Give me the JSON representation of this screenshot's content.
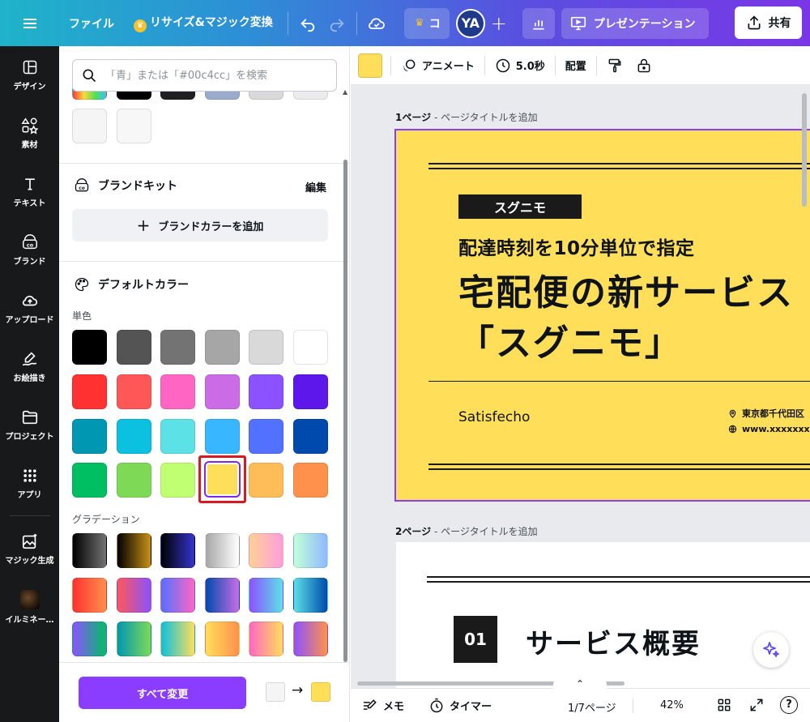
{
  "topbar": {
    "file_label": "ファイル",
    "resize_label": "リサイズ&マジック変換",
    "team_label": "コ",
    "avatar_initials": "YA",
    "present_label": "プレゼンテーション",
    "share_label": "共有",
    "gradient": [
      "#1fb3c9",
      "#7a36e6"
    ]
  },
  "rail": {
    "items": [
      {
        "label": "デザイン",
        "icon": "layout-icon"
      },
      {
        "label": "素材",
        "icon": "shapes-icon"
      },
      {
        "label": "テキスト",
        "icon": "text-icon"
      },
      {
        "label": "ブランド",
        "icon": "brand-icon"
      },
      {
        "label": "アップロード",
        "icon": "cloud-upload-icon"
      },
      {
        "label": "お絵描き",
        "icon": "draw-icon"
      },
      {
        "label": "プロジェクト",
        "icon": "folder-icon"
      },
      {
        "label": "アプリ",
        "icon": "apps-grid-icon"
      },
      {
        "label": "マジック生成",
        "icon": "magic-image-icon"
      },
      {
        "label": "イルミネー…",
        "icon": "thumbnail"
      }
    ]
  },
  "panel": {
    "search_placeholder": "「青」または「#00c4cc」を検索",
    "recent_colors": [
      "gradient",
      "#000000",
      "#202020",
      "#9aaccc",
      "#d9d9d9",
      "#ececec",
      "#f5f5f5",
      "#f7f7f7"
    ],
    "brand_kit_title": "ブランドキット",
    "edit_label": "編集",
    "add_brand_color_label": "ブランドカラーを追加",
    "default_colors_title": "デフォルトカラー",
    "solid_label": "単色",
    "solid_colors": [
      [
        "#000000",
        "#545454",
        "#737373",
        "#a6a6a6",
        "#d9d9d9",
        "#ffffff"
      ],
      [
        "#ff3131",
        "#ff5757",
        "#ff66c4",
        "#cb6ce6",
        "#8c52ff",
        "#5e17eb"
      ],
      [
        "#0097b2",
        "#0cc0df",
        "#5ce1e6",
        "#38b6ff",
        "#5271ff",
        "#004aad"
      ],
      [
        "#00bf63",
        "#7ed957",
        "#c1ff72",
        "#ffde59",
        "#ffbd59",
        "#ff914d"
      ]
    ],
    "selected_color": "#ffde59",
    "gradient_label": "グラデーション",
    "gradients": [
      [
        [
          "#000000",
          "#737373"
        ],
        [
          "#000000",
          "#c89116"
        ],
        [
          "#000000",
          "#3533cd"
        ],
        [
          "#a6a6a6",
          "#ffffff"
        ],
        [
          "#ffd194",
          "#ff9de0"
        ],
        [
          "#c2ffd8",
          "#8fb8ff"
        ]
      ],
      [
        [
          "#ff3131",
          "#ff914d"
        ],
        [
          "#ff5757",
          "#8c52ff"
        ],
        [
          "#5271ff",
          "#ff66c4"
        ],
        [
          "#004aad",
          "#cb6ce6"
        ],
        [
          "#8c52ff",
          "#5ce1e6"
        ],
        [
          "#5ce1e6",
          "#004aad"
        ]
      ],
      [
        [
          "#8c52ff",
          "#00bf63"
        ],
        [
          "#0097b2",
          "#7ed957"
        ],
        [
          "#0cc0df",
          "#ffde59"
        ],
        [
          "#ffde59",
          "#ff914d"
        ],
        [
          "#ff66c4",
          "#ffde59"
        ],
        [
          "#8c52ff",
          "#ff914d"
        ]
      ]
    ],
    "change_all_label": "すべて変更",
    "from_color": "#f5f5f5",
    "to_color": "#ffde59"
  },
  "context_toolbar": {
    "current_color": "#ffde59",
    "animate_label": "アニメート",
    "duration_label": "5.0秒",
    "position_label": "配置"
  },
  "canvas": {
    "page1_label_num": "1ページ",
    "page1_label_title": " - ページタイトルを追加",
    "page2_label_num": "2ページ",
    "page2_label_title": " - ページタイトルを追加",
    "slide1": {
      "tag": "スグニモ",
      "subtitle": "配達時刻を10分単位で指定",
      "title_line1": "宅配便の新サービス",
      "title_line2": "「スグニモ」",
      "brand": "Satisfecho",
      "address": "東京都千代田区",
      "url": "www.xxxxxxxxx",
      "background": "#ffde59"
    },
    "slide2": {
      "number": "01",
      "title": "サービス概要"
    }
  },
  "bottombar": {
    "notes_label": "メモ",
    "timer_label": "タイマー",
    "page_count": "1/7ページ",
    "zoom": "42%"
  }
}
